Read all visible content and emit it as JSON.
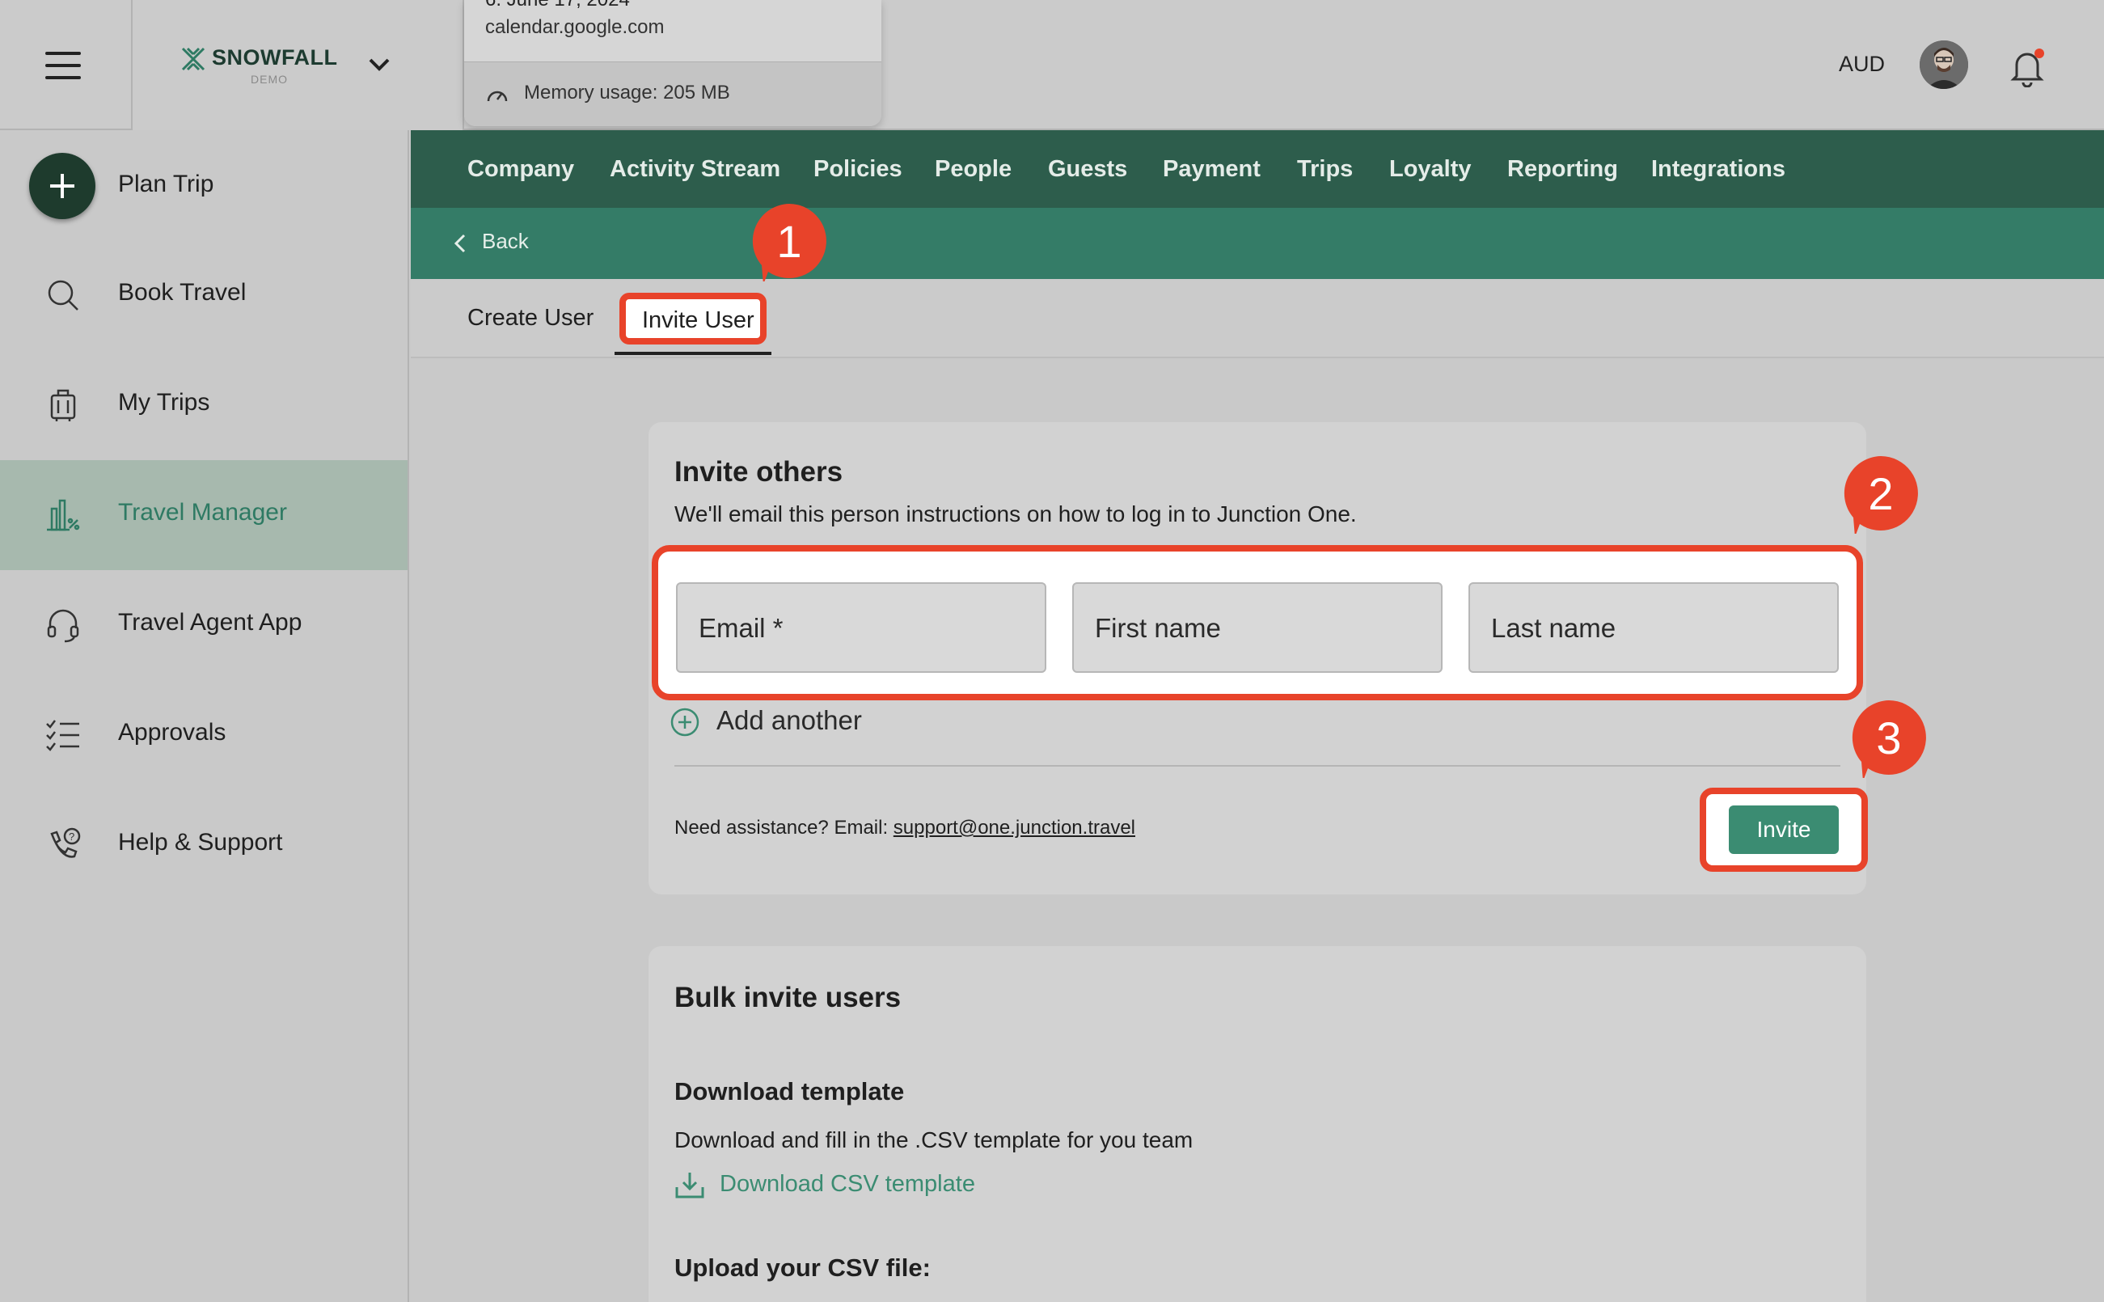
{
  "popup": {
    "date_partial": "6. June 17, 2024",
    "url": "calendar.google.com",
    "memory": "Memory usage: 205 MB"
  },
  "brand": {
    "name": "SNOWFALL",
    "sub": "DEMO"
  },
  "header": {
    "currency": "AUD"
  },
  "sidebar": {
    "items": [
      {
        "label": "Plan Trip",
        "icon": "plus-icon"
      },
      {
        "label": "Book Travel",
        "icon": "search-icon"
      },
      {
        "label": "My Trips",
        "icon": "luggage-icon"
      },
      {
        "label": "Travel Manager",
        "icon": "chart-icon"
      },
      {
        "label": "Travel Agent App",
        "icon": "headset-icon"
      },
      {
        "label": "Approvals",
        "icon": "checklist-icon"
      },
      {
        "label": "Help & Support",
        "icon": "phone-icon"
      }
    ]
  },
  "navbar": {
    "items": [
      "Company",
      "Activity Stream",
      "Policies",
      "People",
      "Guests",
      "Payment",
      "Trips",
      "Loyalty",
      "Reporting",
      "Integrations"
    ]
  },
  "subbar": {
    "back": "Back"
  },
  "tabs": {
    "create_user": "Create User",
    "invite_user": "Invite User"
  },
  "invite": {
    "title": "Invite others",
    "description": "We'll email this person instructions on how to log in to Junction One.",
    "email_placeholder": "Email *",
    "first_name_placeholder": "First name",
    "last_name_placeholder": "Last name",
    "add_another": "Add another",
    "assist_prefix": "Need assistance? Email: ",
    "assist_email": "support@one.junction.travel",
    "invite_button": "Invite"
  },
  "bulk": {
    "title": "Bulk invite users",
    "download_heading": "Download template",
    "download_desc": "Download and fill in the .CSV template for you team",
    "download_link": "Download CSV template",
    "upload_heading": "Upload your CSV file:"
  },
  "annotations": {
    "step1": "1",
    "step2": "2",
    "step3": "3"
  },
  "colors": {
    "accent": "#e8432a",
    "brand_green": "#2d5d4c",
    "button_green": "#3b8c72"
  }
}
